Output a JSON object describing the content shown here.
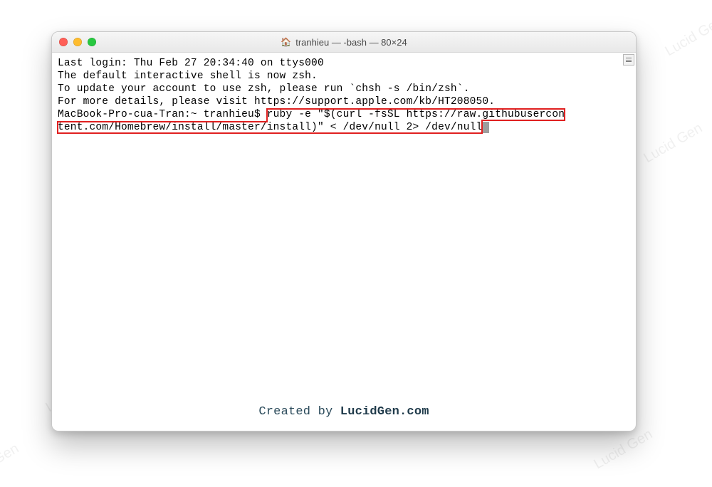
{
  "watermark_text": "Lucid Gen",
  "window": {
    "title": "tranhieu — -bash — 80×24"
  },
  "terminal": {
    "line1": "Last login: Thu Feb 27 20:34:40 on ttys000",
    "blank": "",
    "msg1": "The default interactive shell is now zsh.",
    "msg2": "To update your account to use zsh, please run `chsh -s /bin/zsh`.",
    "msg3": "For more details, please visit https://support.apple.com/kb/HT208050.",
    "prompt_prefix": "MacBook-Pro-cua-Tran:~ tranhieu$ ",
    "cmd_part1": "ruby -e \"$(curl -fsSL https://raw.githubusercon",
    "cmd_part2": "tent.com/Homebrew/install/master/install)\" < /dev/null 2> /dev/null"
  },
  "footer": {
    "prefix": "Created by ",
    "brand": "LucidGen.com"
  }
}
